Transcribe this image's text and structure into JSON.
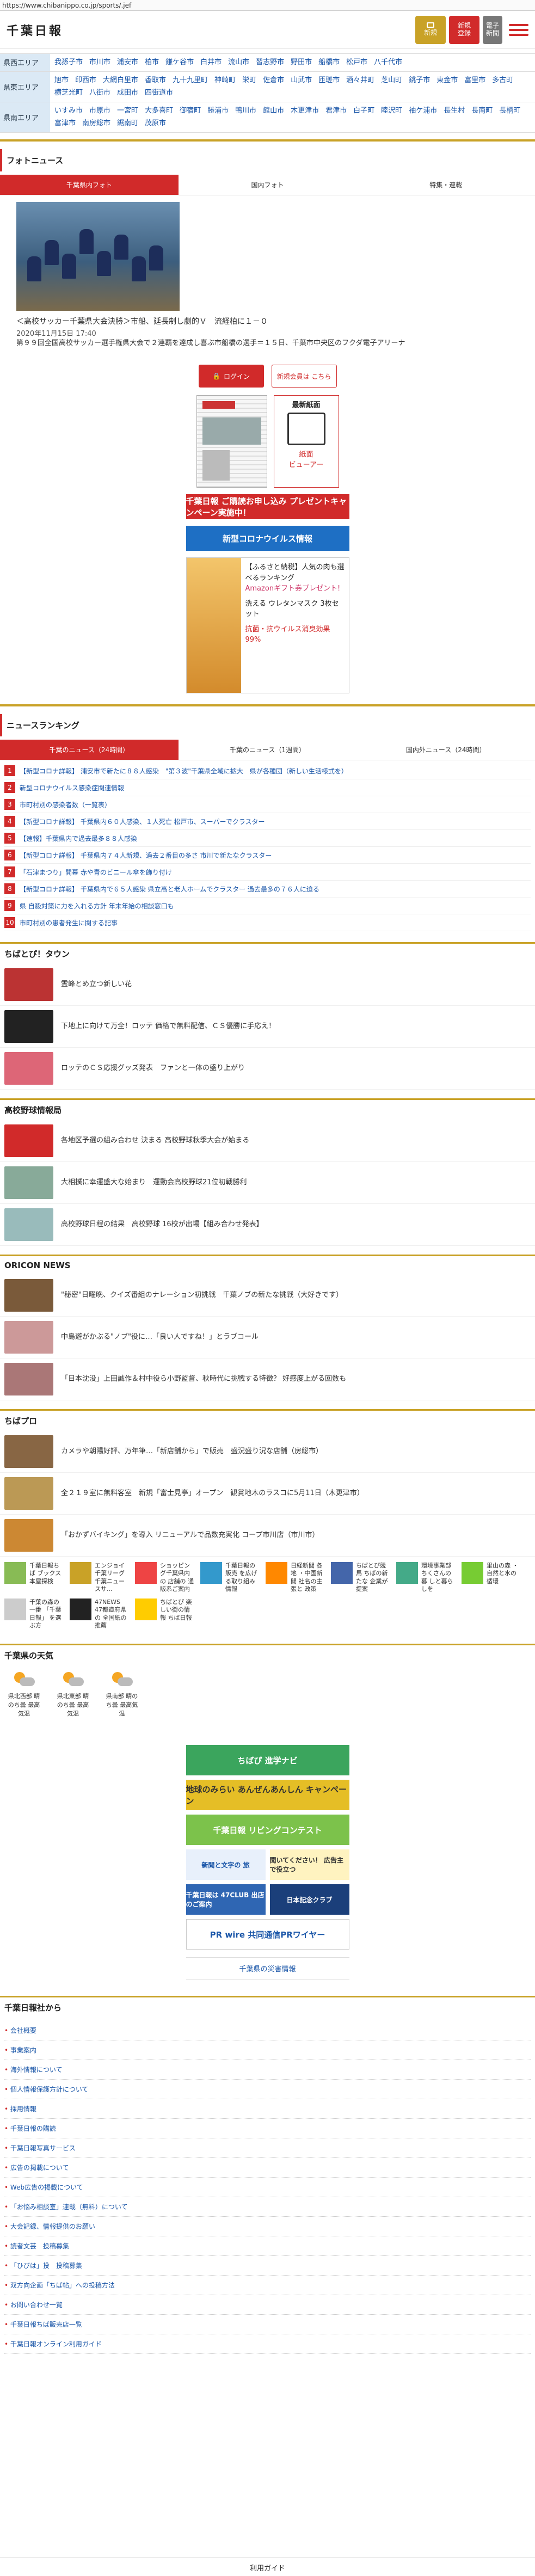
{
  "url": "https://www.chibanippo.co.jp/sports/.jef",
  "header": {
    "logo": "千葉日報",
    "signup_label_1": "新規",
    "signup_label_2": "登録",
    "epaper_label_1": "電子",
    "epaper_label_2": "新聞"
  },
  "areas": [
    {
      "label": "県西エリア",
      "towns": [
        "我孫子市",
        "市川市",
        "浦安市",
        "柏市",
        "鎌ケ谷市",
        "白井市",
        "流山市",
        "習志野市",
        "野田市",
        "船橋市",
        "松戸市",
        "八千代市"
      ]
    },
    {
      "label": "県東エリア",
      "towns": [
        "旭市",
        "印西市",
        "大網白里市",
        "香取市",
        "九十九里町",
        "神崎町",
        "栄町",
        "佐倉市",
        "山武市",
        "匝瑳市",
        "酒々井町",
        "芝山町",
        "銚子市",
        "東金市",
        "富里市",
        "多古町",
        "横芝光町",
        "八街市",
        "成田市",
        "四街道市"
      ]
    },
    {
      "label": "県南エリア",
      "towns": [
        "いすみ市",
        "市原市",
        "一宮町",
        "大多喜町",
        "御宿町",
        "勝浦市",
        "鴨川市",
        "館山市",
        "木更津市",
        "君津市",
        "白子町",
        "睦沢町",
        "袖ケ浦市",
        "長生村",
        "長南町",
        "長柄町",
        "富津市",
        "南房総市",
        "鋸南町",
        "茂原市"
      ]
    }
  ],
  "photo_news": {
    "title": "フォトニュース",
    "tabs": [
      "千葉県内フォト",
      "国内フォト",
      "特集・連載"
    ],
    "caption": "＜高校サッカー千葉県大会決勝＞市船、延長制し劇的Ｖ　流経柏に１－０",
    "date": "2020年11月15日 17:40",
    "body": "第９９回全国高校サッカー選手権県大会で２連覇を達成し喜ぶ市船橋の選手＝１５日、千葉市中央区のフクダ電子アリーナ"
  },
  "side": {
    "login": "ログイン",
    "register": "新規会員は こちら",
    "newest_paper": "最新紙面",
    "viewer_1": "紙面",
    "viewer_2": "ビューアー",
    "banner_present": "千葉日報 ご購読お申し込み プレゼントキャンペーン実施中！",
    "banner_corona": "新型コロナウイルス情報",
    "ad_line1": "【ふるさと納税】人気の肉も選べるランキング",
    "ad_line2": "Amazonギフト券プレゼント!",
    "ad_line3": "洗える ウレタンマスク 3枚セット",
    "ad_line4": "抗菌・抗ウイルス消臭効果99%"
  },
  "ranking": {
    "title": "ニュースランキング",
    "tabs": [
      "千葉のニュース（24時間）",
      "千葉のニュース（1週間）",
      "国内外ニュース（24時間）"
    ],
    "items": [
      "【新型コロナ詳報】 浦安市で新たに８８人感染　\"第３波\"千葉県全域に拡大　県が各種団（新しい生活様式を）",
      "新型コロナウイルス感染症関連情報",
      "市町村別の感染者数（一覧表）",
      "【新型コロナ詳報】 千葉県内６０人感染、１人死亡 松戸市、スーパーでクラスター",
      "【速報】千葉県内で過去最多８８人感染",
      "【新型コロナ詳報】 千葉県内７４人新規、過去２番目の多さ 市川で新たなクラスター",
      "「石津まつり」開幕 赤や青のビニール傘を飾り付け",
      "【新型コロナ詳報】 千葉県内で６５人感染 県立高と老人ホームでクラスター 過去最多の７６人に迫る",
      "県 自殺対策に力を入れる方針 年末年始の相談窓口も",
      "市町村別の患者発生に関する記事"
    ]
  },
  "chiba_town": {
    "title": "ちばとぴ！タウン",
    "items": [
      "霊峰とめ立つ新しい花",
      "下地上に向けて万全！ロッテ 価格で無料配信、ＣＳ優勝に手応え！",
      "ロッテのＣＳ応援グッズ発表　ファンと一体の盛り上がり"
    ]
  },
  "hs_sports": {
    "title": "高校野球情報局",
    "items": [
      "各地区予選の組み合わせ 決まる 高校野球秋季大会が始まる",
      "大相撲に幸運盛大な始まり　運動会高校野球21位初戦勝利",
      "高校野球日程の結果　高校野球 16校が出場【組み合わせ発表】"
    ]
  },
  "oricon": {
    "title": "ORICON NEWS",
    "items": [
      "\"秘密\"日曜晩、クイズ番組のナレーション初挑戦　千葉ノブの新たな挑戦（大好きです）",
      "中島遊がかぶる\"ノブ\"役に…「良い人ですね！」とラブコール",
      "「日本沈没」上田誠作＆村中役ら小野監督、秋時代に挑戦する特徴？ 好感度上がる回数も"
    ]
  },
  "chibapro": {
    "title": "ちばプロ",
    "items": [
      "カメラや朝陽好評、万年筆…「新店舗から」で販売　盛況盛り況な店舗（房総市）",
      "全２１９室に無料客室　新規「富士見亭」オープン　観賞地木のラスコに5月11日（木更津市）",
      "「おかずバイキング」を導入 リニューアルで品数充実化 コープ市川店（市川市）"
    ]
  },
  "links": [
    "千葉日報ちば ブックス 本屋探検",
    "エンジョイ千葉リーグ 千葉ニュースサ...",
    "ショッピング千葉県内の 店舗の 通販系ご案内",
    "千葉日報の販売 を広げる取り組み 情報",
    "日経新聞 各地 ・中国新聞 社名の主張と 政策",
    "ちばとぴ競馬 ちばの新たな 企業が提案",
    "環境事業部 ちくさんの暮 しと暮らしを",
    "里山の森 ・自然と水の 循環",
    "千葉の森の一番 「千葉日報」 を選ぶ方",
    "47NEWS 47都道府県の 全国紙の 推薦",
    "ちばとぴ 楽しい街の情報 ちば日報"
  ],
  "weather": {
    "title": "千葉県の天気",
    "cells": [
      {
        "label": "県北西部 晴のち曇 最高気温"
      },
      {
        "label": "県北東部 晴のち曇 最高気温"
      },
      {
        "label": "県南部 晴のち曇 最高気温"
      }
    ]
  },
  "ads": {
    "navi": "ちばぴ 進学ナビ",
    "anzen": "地球のみらい あんぜんあんしん キャンペーン",
    "campaign": "千葉日報 リビングコンテスト",
    "keyword_1": "新聞と文字の 旅",
    "keyword_2": "聞いてください！ 広告主で役立つ",
    "club_1": "千葉日報は 47CLUB 出店のご案内",
    "club_2": "日本記念クラブ",
    "prwire": "PR wire 共同通信PRワイヤー",
    "disaster": "千葉県の災害情報"
  },
  "company": {
    "title": "千葉日報社から",
    "items": [
      "会社概要",
      "事業案内",
      "海外情報について",
      "個人情報保護方針について",
      "採用情報",
      "千葉日報の購読",
      "千葉日報写真サービス",
      "広告の掲載について",
      "Web広告の掲載について",
      "「お悩み相談室」連載（無料）について",
      "大会記録、情報提供のお願い",
      "読者文芸　投稿募集",
      "「ひびは」投　投稿募集",
      "双方向企画「ちば帖」への投稿方法",
      "お問い合わせ一覧",
      "千葉日報ちば販売店一覧",
      "千葉日報オンライン利用ガイド"
    ]
  },
  "footer": "利用ガイド"
}
